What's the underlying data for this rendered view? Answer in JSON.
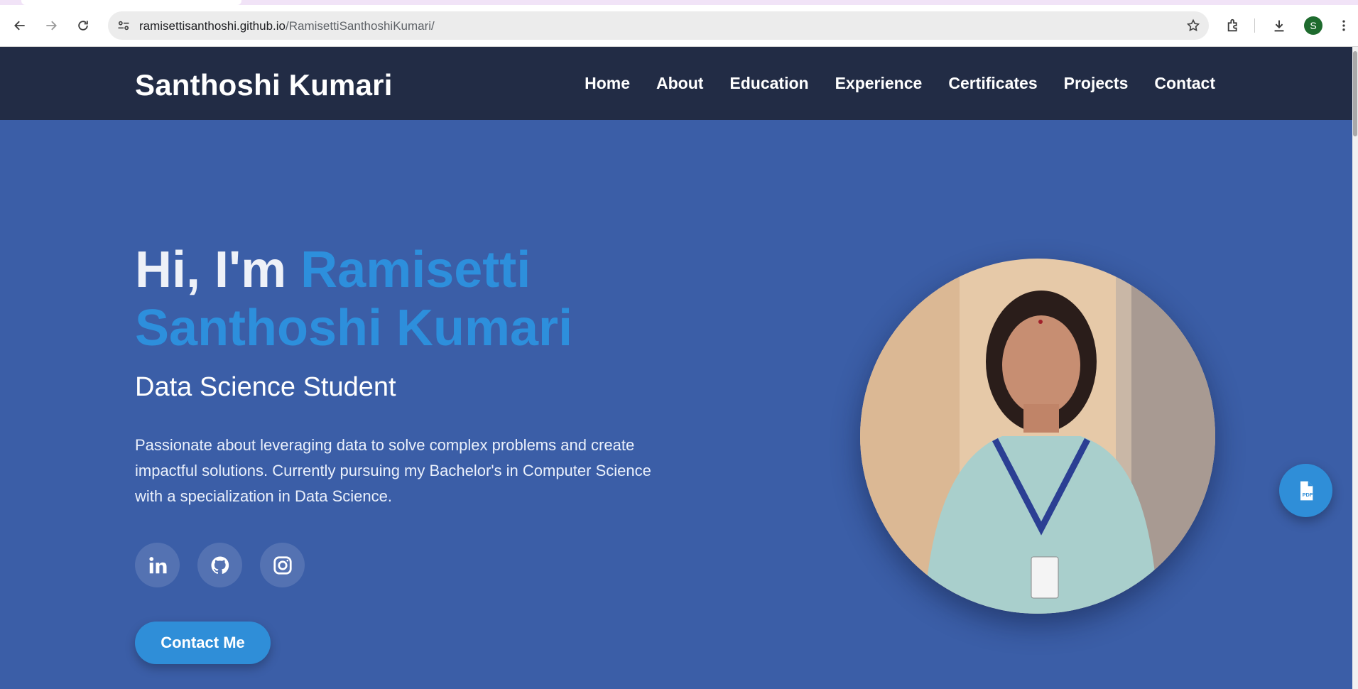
{
  "browser": {
    "url_host": "ramisettisanthoshi.github.io",
    "url_path": "/RamisettiSanthoshiKumari/",
    "profile_initial": "S"
  },
  "header": {
    "brand": "Santhoshi Kumari",
    "nav": [
      "Home",
      "About",
      "Education",
      "Experience",
      "Certificates",
      "Projects",
      "Contact"
    ]
  },
  "hero": {
    "greeting": "Hi, I'm ",
    "name": "Ramisetti Santhoshi Kumari",
    "subtitle": "Data Science Student",
    "description": "Passionate about leveraging data to solve complex problems and create impactful solutions. Currently pursuing my Bachelor's in Computer Science with a specialization in Data Science.",
    "socials": [
      {
        "icon": "linkedin-icon"
      },
      {
        "icon": "github-icon"
      },
      {
        "icon": "instagram-icon"
      }
    ],
    "cta_label": "Contact Me"
  },
  "fab": {
    "icon": "pdf-file-icon"
  },
  "colors": {
    "header_bg": "#222c45",
    "hero_bg": "#3b5ea7",
    "accent": "#2d8fdc"
  }
}
